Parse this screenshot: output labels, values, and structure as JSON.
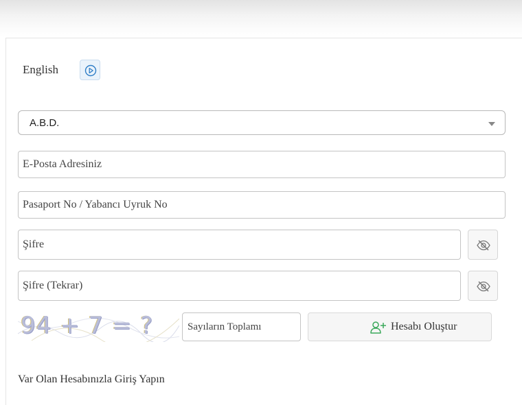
{
  "language": {
    "label": "English",
    "switch_icon": "play-circle-icon"
  },
  "form": {
    "country_select": {
      "value": "A.B.D."
    },
    "email": {
      "placeholder": "E-Posta Adresiniz",
      "value": ""
    },
    "passport": {
      "placeholder": "Pasaport No / Yabancı Uyruk No",
      "value": ""
    },
    "password": {
      "placeholder": "Şifre",
      "value": "",
      "toggle_icon": "eye-slash-icon"
    },
    "password_repeat": {
      "placeholder": "Şifre (Tekrar)",
      "value": "",
      "toggle_icon": "eye-slash-icon"
    },
    "captcha": {
      "image_text": "94 + 7 = ?",
      "answer_placeholder": "Sayıların Toplamı",
      "answer_value": ""
    },
    "create_button": {
      "label": "Hesabı Oluştur",
      "icon": "user-plus-icon"
    }
  },
  "login_link": {
    "label": "Var Olan Hesabınızla Giriş Yapın"
  },
  "colors": {
    "accent": "#3aa85a",
    "link_blue": "#2f7ec7"
  }
}
